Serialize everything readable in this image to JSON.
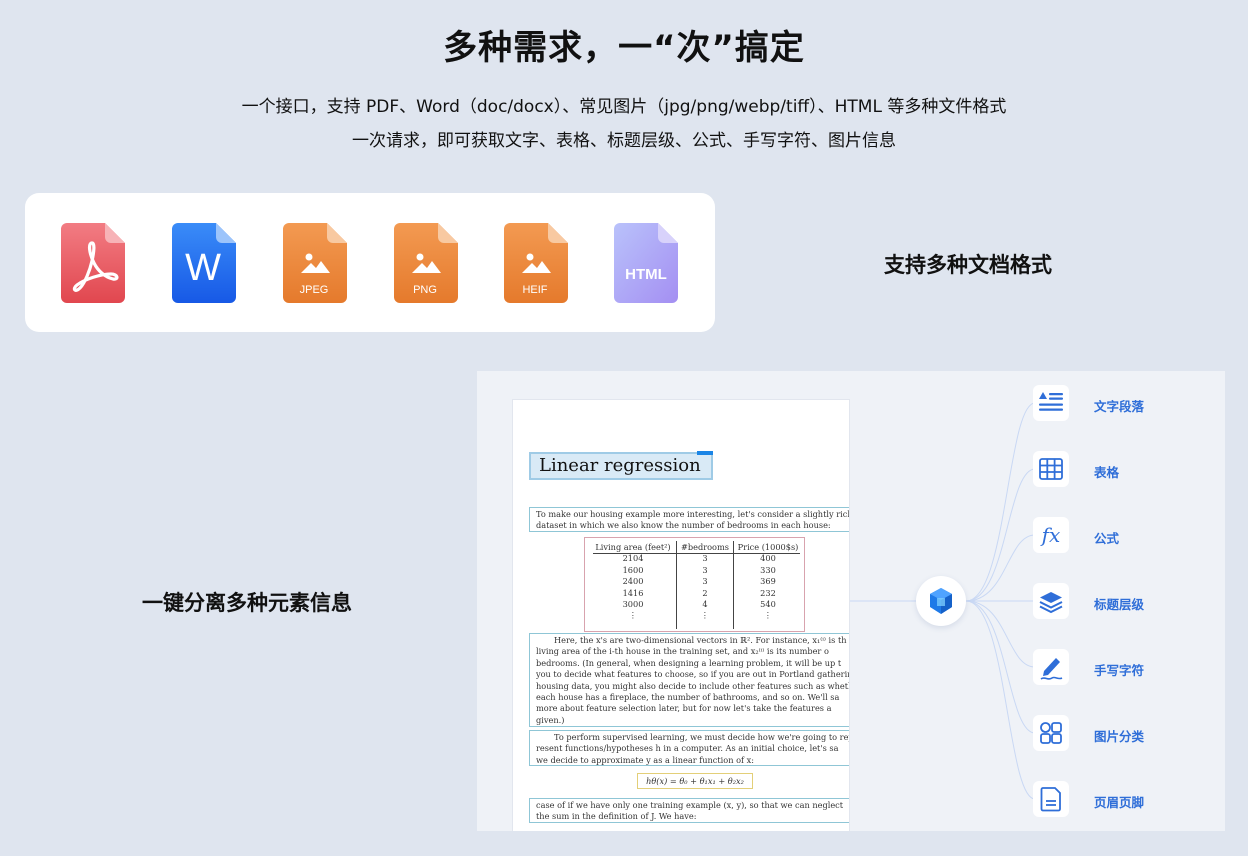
{
  "header": {
    "title": "多种需求，一“次”搞定",
    "subtitle_line1": "一个接口，支持 PDF、Word（doc/docx）、常见图片（jpg/png/webp/tiff）、HTML 等多种文件格式",
    "subtitle_line2": "一次请求，即可获取文字、表格、标题层级、公式、手写字符、图片信息"
  },
  "formats": {
    "label": "支持多种文档格式",
    "items": [
      {
        "name": "pdf-file-icon",
        "text": ""
      },
      {
        "name": "word-file-icon",
        "text": "W"
      },
      {
        "name": "jpeg-file-icon",
        "text": "JPEG"
      },
      {
        "name": "png-file-icon",
        "text": "PNG"
      },
      {
        "name": "heif-file-icon",
        "text": "HEIF"
      },
      {
        "name": "html-file-icon",
        "text": "HTML"
      }
    ],
    "colors": {
      "pdf": "#e9545f",
      "word": "#1f6ff0",
      "image": "#ec8a3c",
      "html": "#a9a9f6"
    }
  },
  "separation": {
    "label": "一键分离多种元素信息"
  },
  "document": {
    "title": "Linear regression",
    "para1": [
      "To make our housing example more interesting, let's consider a slightly riche",
      "dataset in which we also know the number of bedrooms in each house:"
    ],
    "table": {
      "headers": [
        "Living area (feet²)",
        "#bedrooms",
        "Price (1000$s)"
      ],
      "rows": [
        [
          "2104",
          "3",
          "400"
        ],
        [
          "1600",
          "3",
          "330"
        ],
        [
          "2400",
          "3",
          "369"
        ],
        [
          "1416",
          "2",
          "232"
        ],
        [
          "3000",
          "4",
          "540"
        ],
        [
          "⋮",
          "⋮",
          "⋮"
        ]
      ]
    },
    "para2": [
      "Here, the x's are two-dimensional vectors in ℝ². For instance, x₁⁽ⁱ⁾ is th",
      "living area of the i-th house in the training set, and x₂⁽ⁱ⁾ is its number o",
      "bedrooms. (In general, when designing a learning problem, it will be up t",
      "you to decide what features to choose, so if you are out in Portland gatherin",
      "housing data, you might also decide to include other features such as whethe",
      "each house has a fireplace, the number of bathrooms, and so on. We'll sa",
      "more about feature selection later, but for now let's take the features a",
      "given.)"
    ],
    "para3": [
      "To perform supervised learning, we must decide how we're going to rep",
      "resent functions/hypotheses h in a computer. As an initial choice, let's sa",
      "we decide to approximate y as a linear function of x:"
    ],
    "formula": "hθ(x) = θ₀ + θ₁x₁ + θ₂x₂",
    "para4": [
      "case of if we have only one training example (x, y), so that we can neglect",
      "the sum in the definition of J. We have:"
    ]
  },
  "features": [
    {
      "icon": "text-paragraph-icon",
      "label": "文字段落"
    },
    {
      "icon": "table-icon",
      "label": "表格"
    },
    {
      "icon": "formula-fx-icon",
      "label": "公式"
    },
    {
      "icon": "layers-icon",
      "label": "标题层级"
    },
    {
      "icon": "handwriting-pen-icon",
      "label": "手写字符"
    },
    {
      "icon": "image-category-icon",
      "label": "图片分类"
    },
    {
      "icon": "header-footer-icon",
      "label": "页眉页脚"
    }
  ],
  "accent_color": "#2f6ed8"
}
